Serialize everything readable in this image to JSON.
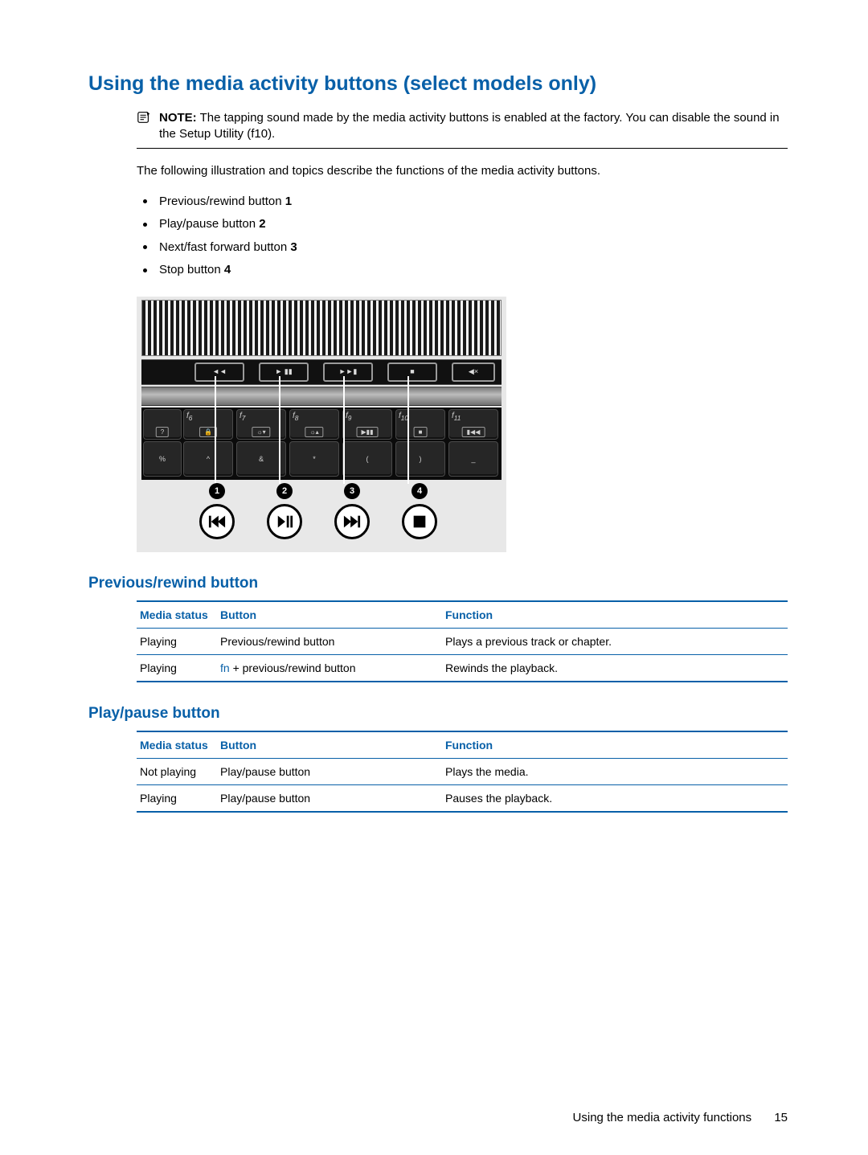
{
  "heading": "Using the media activity buttons (select models only)",
  "note_label": "NOTE:",
  "note_text": "The tapping sound made by the media activity buttons is enabled at the factory. You can disable the sound in the Setup Utility (f10).",
  "intro": "The following illustration and topics describe the functions of the media activity buttons.",
  "bullets": [
    {
      "text": "Previous/rewind button ",
      "num": "1"
    },
    {
      "text": "Play/pause button ",
      "num": "2"
    },
    {
      "text": "Next/fast forward button ",
      "num": "3"
    },
    {
      "text": "Stop button ",
      "num": "4"
    }
  ],
  "section1_title": "Previous/rewind button",
  "section2_title": "Play/pause button",
  "table_headers": {
    "c1": "Media status",
    "c2": "Button",
    "c3": "Function"
  },
  "table1": [
    {
      "status": "Playing",
      "button_prefix": "",
      "button": "Previous/rewind button",
      "fn": "Plays a previous track or chapter."
    },
    {
      "status": "Playing",
      "button_prefix": "fn",
      "button": " + previous/rewind button",
      "fn": "Rewinds the playback."
    }
  ],
  "table2": [
    {
      "status": "Not playing",
      "button_prefix": "",
      "button": "Play/pause button",
      "fn": "Plays the media."
    },
    {
      "status": "Playing",
      "button_prefix": "",
      "button": "Play/pause button",
      "fn": "Pauses the playback."
    }
  ],
  "illus_callouts": [
    "1",
    "2",
    "3",
    "4"
  ],
  "footer_text": "Using the media activity functions",
  "page_number": "15"
}
